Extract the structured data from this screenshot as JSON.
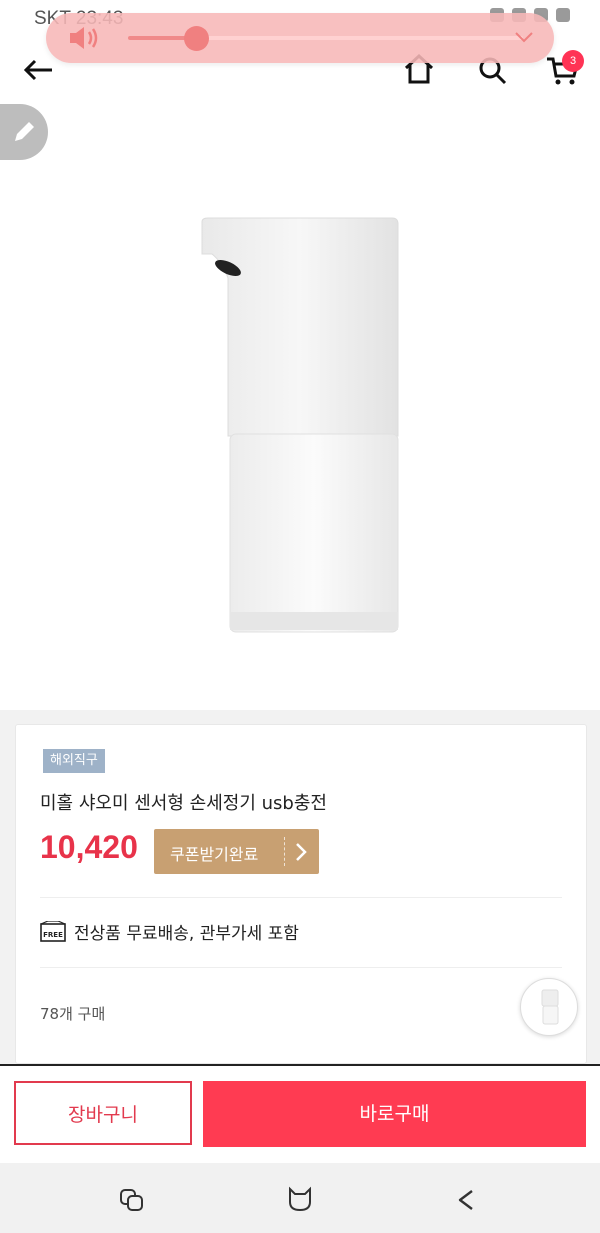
{
  "status_bar": {
    "carrier_time": "SKT 23:43"
  },
  "volume_panel": {
    "level_percent": 20
  },
  "header": {
    "cart_count": "3"
  },
  "product": {
    "badge": "해외직구",
    "title": "미홀 샤오미 센서형 손세정기 usb충전",
    "price": "10,420",
    "coupon_label": "쿠폰받기완료",
    "shipping_text": "전상품 무료배송, 관부가세 포함",
    "free_icon_text": "FREE",
    "sold_count": "78개 구매"
  },
  "actions": {
    "cart_button": "장바구니",
    "buy_button": "바로구매"
  },
  "colors": {
    "accent_red": "#ff3b52",
    "price_red": "#e8334a",
    "coupon_brown": "#c8a072",
    "badge_blue": "#9eb2c8"
  }
}
